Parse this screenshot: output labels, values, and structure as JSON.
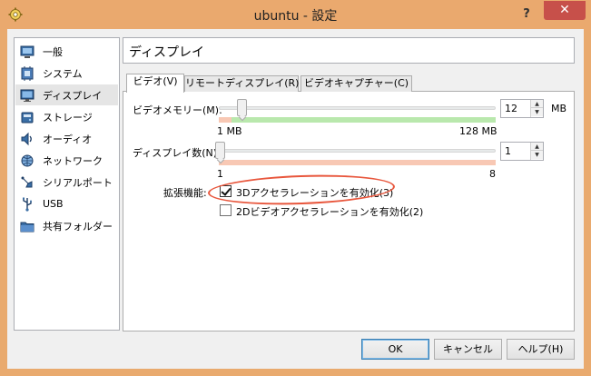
{
  "window": {
    "title": "ubuntu - 設定",
    "help_label": "?",
    "close_label": "✕"
  },
  "sidebar": {
    "items": [
      {
        "label": "一般",
        "icon": "general-icon"
      },
      {
        "label": "システム",
        "icon": "system-icon"
      },
      {
        "label": "ディスプレイ",
        "icon": "display-icon",
        "selected": true
      },
      {
        "label": "ストレージ",
        "icon": "storage-icon"
      },
      {
        "label": "オーディオ",
        "icon": "audio-icon"
      },
      {
        "label": "ネットワーク",
        "icon": "network-icon"
      },
      {
        "label": "シリアルポート",
        "icon": "serial-port-icon"
      },
      {
        "label": "USB",
        "icon": "usb-icon"
      },
      {
        "label": "共有フォルダー",
        "icon": "shared-folder-icon"
      }
    ]
  },
  "page": {
    "title": "ディスプレイ"
  },
  "tabs": [
    {
      "label": "ビデオ(V)",
      "active": true
    },
    {
      "label": "リモートディスプレイ(R)"
    },
    {
      "label": "ビデオキャプチャー(C)"
    }
  ],
  "video": {
    "memory": {
      "label": "ビデオメモリー(M):",
      "value": "12",
      "unit": "MB",
      "min_label": "1 MB",
      "max_label": "128 MB",
      "min": 1,
      "max": 128,
      "current": 12
    },
    "monitors": {
      "label": "ディスプレイ数(N):",
      "value": "1",
      "min_label": "1",
      "max_label": "8",
      "min": 1,
      "max": 8,
      "current": 1
    },
    "extended": {
      "label": "拡張機能:",
      "accel_3d": {
        "label": "3Dアクセラレーションを有効化(3)",
        "checked": true
      },
      "accel_2d": {
        "label": "2Dビデオアクセラレーションを有効化(2)",
        "checked": false
      }
    }
  },
  "buttons": {
    "ok": "OK",
    "cancel": "キャンセル",
    "help": "ヘルプ(H)"
  },
  "colors": {
    "titlebar": "#eaa96e",
    "close": "#c7504a",
    "safe_zone": "#b9e8ad",
    "warn_zone": "#f8c8b4",
    "highlight": "#e8563c"
  }
}
